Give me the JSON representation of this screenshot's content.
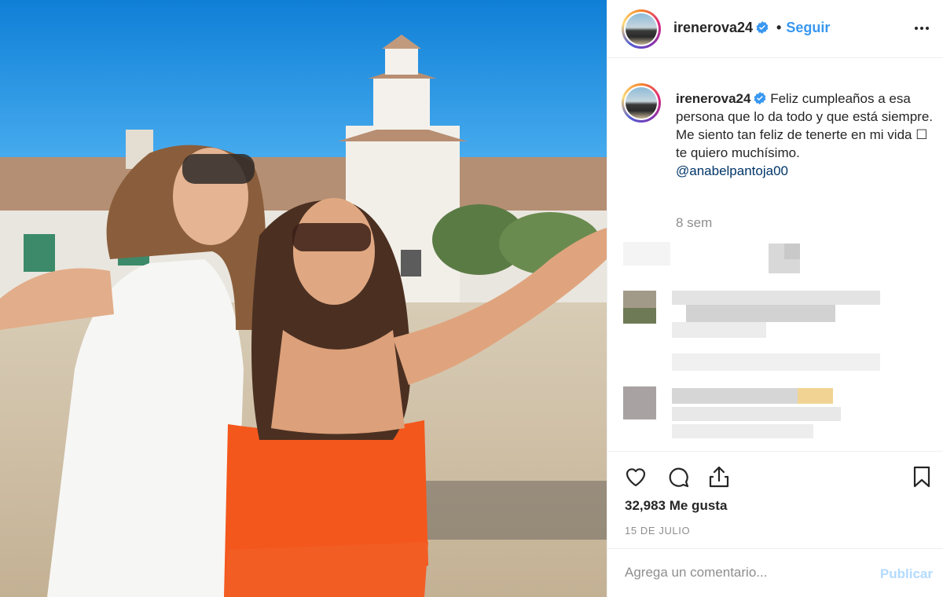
{
  "post": {
    "username": "irenerova24",
    "follow_label": "Seguir",
    "separator": "•",
    "caption_lines": [
      "Feliz cumpleaños a esa persona que lo da todo y que está siempre.",
      "Me siento tan feliz de tenerte en mi vida ☐ te quiero muchísimo."
    ],
    "mention": "@anabelpantoja00",
    "time_ago": "8 sem",
    "likes_text": "32,983 Me gusta",
    "date": "15 DE JULIO"
  },
  "comment_box": {
    "placeholder": "Agrega un comentario...",
    "publish_label": "Publicar"
  },
  "icons": {
    "verified": "verified-badge-icon",
    "more": "more-options-icon",
    "like": "heart-icon",
    "comment": "comment-icon",
    "share": "share-icon",
    "save": "bookmark-icon"
  },
  "colors": {
    "accent_blue": "#3897f0",
    "verified_blue": "#3897f0",
    "mention": "#003569",
    "muted": "#8e8e8e",
    "publish_disabled": "#b3dbff"
  }
}
